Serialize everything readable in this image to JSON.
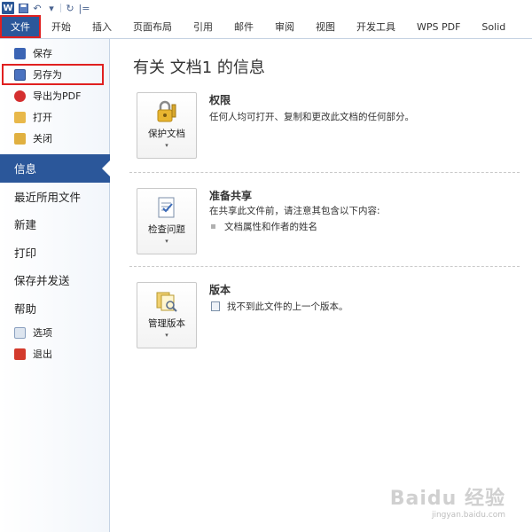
{
  "qat": {
    "logo": "W",
    "undo_glyph": "↶",
    "redo_glyph": "↻",
    "more_glyph": "|="
  },
  "tabs": [
    {
      "label": "文件"
    },
    {
      "label": "开始"
    },
    {
      "label": "插入"
    },
    {
      "label": "页面布局"
    },
    {
      "label": "引用"
    },
    {
      "label": "邮件"
    },
    {
      "label": "审阅"
    },
    {
      "label": "视图"
    },
    {
      "label": "开发工具"
    },
    {
      "label": "WPS PDF"
    },
    {
      "label": "Solid"
    }
  ],
  "nav": {
    "save": "保存",
    "save_as": "另存为",
    "export_pdf": "导出为PDF",
    "open": "打开",
    "close": "关闭",
    "info": "信息",
    "recent": "最近所用文件",
    "new": "新建",
    "print": "打印",
    "save_send": "保存并发送",
    "help": "帮助",
    "options": "选项",
    "exit": "退出"
  },
  "main": {
    "title": "有关 文档1 的信息",
    "permissions": {
      "button": "保护文档",
      "heading": "权限",
      "desc": "任何人均可打开、复制和更改此文档的任何部分。"
    },
    "prepare": {
      "button": "检查问题",
      "heading": "准备共享",
      "desc": "在共享此文件前，请注意其包含以下内容:",
      "bullet": "文档属性和作者的姓名"
    },
    "versions": {
      "button": "管理版本",
      "heading": "版本",
      "desc": "找不到此文件的上一个版本。"
    },
    "caret": "▾"
  },
  "watermark": {
    "main": "Baidu 经验",
    "sub": "jingyan.baidu.com"
  },
  "colors": {
    "accent": "#2b579a",
    "highlight": "#e02020"
  }
}
